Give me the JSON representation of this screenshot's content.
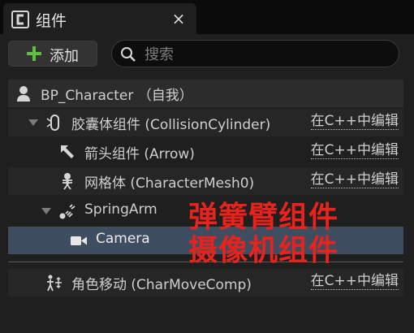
{
  "tab": {
    "title": "组件",
    "close": "×"
  },
  "toolbar": {
    "add_label": "添加",
    "search_placeholder": "搜索"
  },
  "tree": {
    "root": "BP_Character （自我）",
    "items": [
      {
        "label": "胶囊体组件 (CollisionCylinder)",
        "edit": "在C++中编辑",
        "icon": "capsule-icon"
      },
      {
        "label": "箭头组件 (Arrow)",
        "edit": "在C++中编辑",
        "icon": "arrow-icon"
      },
      {
        "label": "网格体 (CharacterMesh0)",
        "edit": "在C++中编辑",
        "icon": "skeleton-icon"
      },
      {
        "label": "SpringArm",
        "icon": "spring-arm-icon"
      },
      {
        "label": "Camera",
        "icon": "camera-icon"
      }
    ],
    "movement": {
      "label": "角色移动 (CharMoveComp)",
      "edit": "在C++中编辑",
      "icon": "movement-icon"
    }
  },
  "annotations": {
    "spring_arm": "弹簧臂组件",
    "camera": "摄像机组件"
  },
  "colors": {
    "selected_row": "#3e4d60",
    "annotation": "#e8231d",
    "add_plus": "#5fbf3f"
  }
}
